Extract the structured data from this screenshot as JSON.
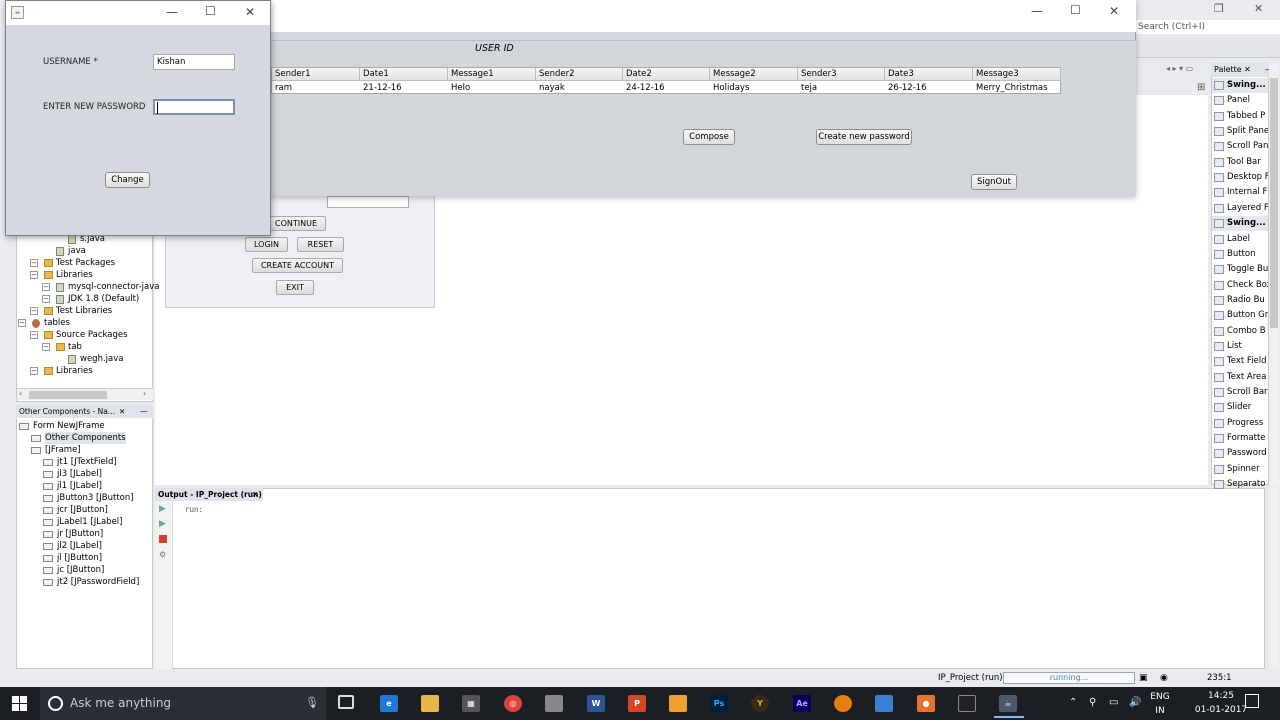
{
  "ide": {
    "search_placeholder": "Search (Ctrl+I)",
    "project_tree": [
      {
        "label": "s.java",
        "indent": 3,
        "kind": "file"
      },
      {
        "label": "java",
        "indent": 2,
        "kind": "file"
      },
      {
        "label": "Test Packages",
        "indent": 1,
        "kind": "folder"
      },
      {
        "label": "Libraries",
        "indent": 1,
        "kind": "folder"
      },
      {
        "label": "mysql-connector-java",
        "indent": 2,
        "kind": "jar"
      },
      {
        "label": "JDK 1.8 (Default)",
        "indent": 2,
        "kind": "jar"
      },
      {
        "label": "Test Libraries",
        "indent": 1,
        "kind": "folder"
      },
      {
        "label": "tables",
        "indent": 0,
        "kind": "project"
      },
      {
        "label": "Source Packages",
        "indent": 1,
        "kind": "folder"
      },
      {
        "label": "tab",
        "indent": 2,
        "kind": "package"
      },
      {
        "label": "wegh.java",
        "indent": 3,
        "kind": "file"
      },
      {
        "label": "Libraries",
        "indent": 1,
        "kind": "folder"
      }
    ],
    "navigator": {
      "tab_title": "Other Components - Na...",
      "items": [
        {
          "label": "Form NewJFrame",
          "indent": 0
        },
        {
          "label": "Other Components",
          "indent": 1
        },
        {
          "label": "[JFrame]",
          "indent": 1
        },
        {
          "label": "jt1 [JTextField]",
          "indent": 2
        },
        {
          "label": "jl3 [JLabel]",
          "indent": 2
        },
        {
          "label": "jl1 [JLabel]",
          "indent": 2
        },
        {
          "label": "jButton3 [JButton]",
          "indent": 2
        },
        {
          "label": "jcr [JButton]",
          "indent": 2
        },
        {
          "label": "jLabel1 [JLabel]",
          "indent": 2
        },
        {
          "label": "jr [JButton]",
          "indent": 2
        },
        {
          "label": "jl2 [JLabel]",
          "indent": 2
        },
        {
          "label": "jl [JButton]",
          "indent": 2
        },
        {
          "label": "jc [JButton]",
          "indent": 2
        },
        {
          "label": "jt2 [JPasswordField]",
          "indent": 2
        }
      ]
    },
    "designer_form": {
      "continue_label": "CONTINUE",
      "login_label": "LOGIN",
      "reset_label": "RESET",
      "create_account_label": "CREATE ACCOUNT",
      "exit_label": "EXIT"
    },
    "output": {
      "tab_title": "Output - IP_Project (run)",
      "text": "run:"
    },
    "palette": {
      "title": "Palette",
      "items": [
        {
          "label": "Swing...",
          "category": true
        },
        {
          "label": "Panel",
          "category": false
        },
        {
          "label": "Tabbed P",
          "category": false
        },
        {
          "label": "Split Pane",
          "category": false
        },
        {
          "label": "Scroll Pan",
          "category": false
        },
        {
          "label": "Tool Bar",
          "category": false
        },
        {
          "label": "Desktop F",
          "category": false
        },
        {
          "label": "Internal F",
          "category": false
        },
        {
          "label": "Layered F",
          "category": false
        },
        {
          "label": "Swing...",
          "category": true
        },
        {
          "label": "Label",
          "category": false
        },
        {
          "label": "Button",
          "category": false
        },
        {
          "label": "Toggle Bu",
          "category": false
        },
        {
          "label": "Check Box",
          "category": false
        },
        {
          "label": "Radio Bu",
          "category": false
        },
        {
          "label": "Button Gr",
          "category": false
        },
        {
          "label": "Combo B",
          "category": false
        },
        {
          "label": "List",
          "category": false
        },
        {
          "label": "Text Field",
          "category": false
        },
        {
          "label": "Text Area",
          "category": false
        },
        {
          "label": "Scroll Bar",
          "category": false
        },
        {
          "label": "Slider",
          "category": false
        },
        {
          "label": "Progress",
          "category": false
        },
        {
          "label": "Formatte",
          "category": false
        },
        {
          "label": "Password",
          "category": false
        },
        {
          "label": "Spinner",
          "category": false
        },
        {
          "label": "Separato",
          "category": false
        }
      ]
    },
    "status": {
      "project": "IP_Project (run)",
      "progress_text": "running...",
      "position": "235:1"
    }
  },
  "main_window": {
    "user_id_label": "USER ID",
    "table": {
      "headers": [
        "Sender1",
        "Date1",
        "Message1",
        "Sender2",
        "Date2",
        "Message2",
        "Sender3",
        "Date3",
        "Message3"
      ],
      "rows": [
        [
          "ram",
          "21-12-16",
          "Helo",
          "nayak",
          "24-12-16",
          "Holidays",
          "teja",
          "26-12-16",
          "Merry_Christmas"
        ]
      ]
    },
    "compose_label": "Compose",
    "create_password_label": "Create new password",
    "signout_label": "SignOut"
  },
  "dialog": {
    "username_label": "USERNAME *",
    "username_value": "Kishan",
    "password_label": "ENTER NEW PASSWORD",
    "password_value": "",
    "change_label": "Change"
  },
  "taskbar": {
    "search_placeholder": "Ask me anything",
    "lang_top": "ENG",
    "lang_bottom": "IN",
    "time": "14:25",
    "date": "01-01-2017"
  }
}
